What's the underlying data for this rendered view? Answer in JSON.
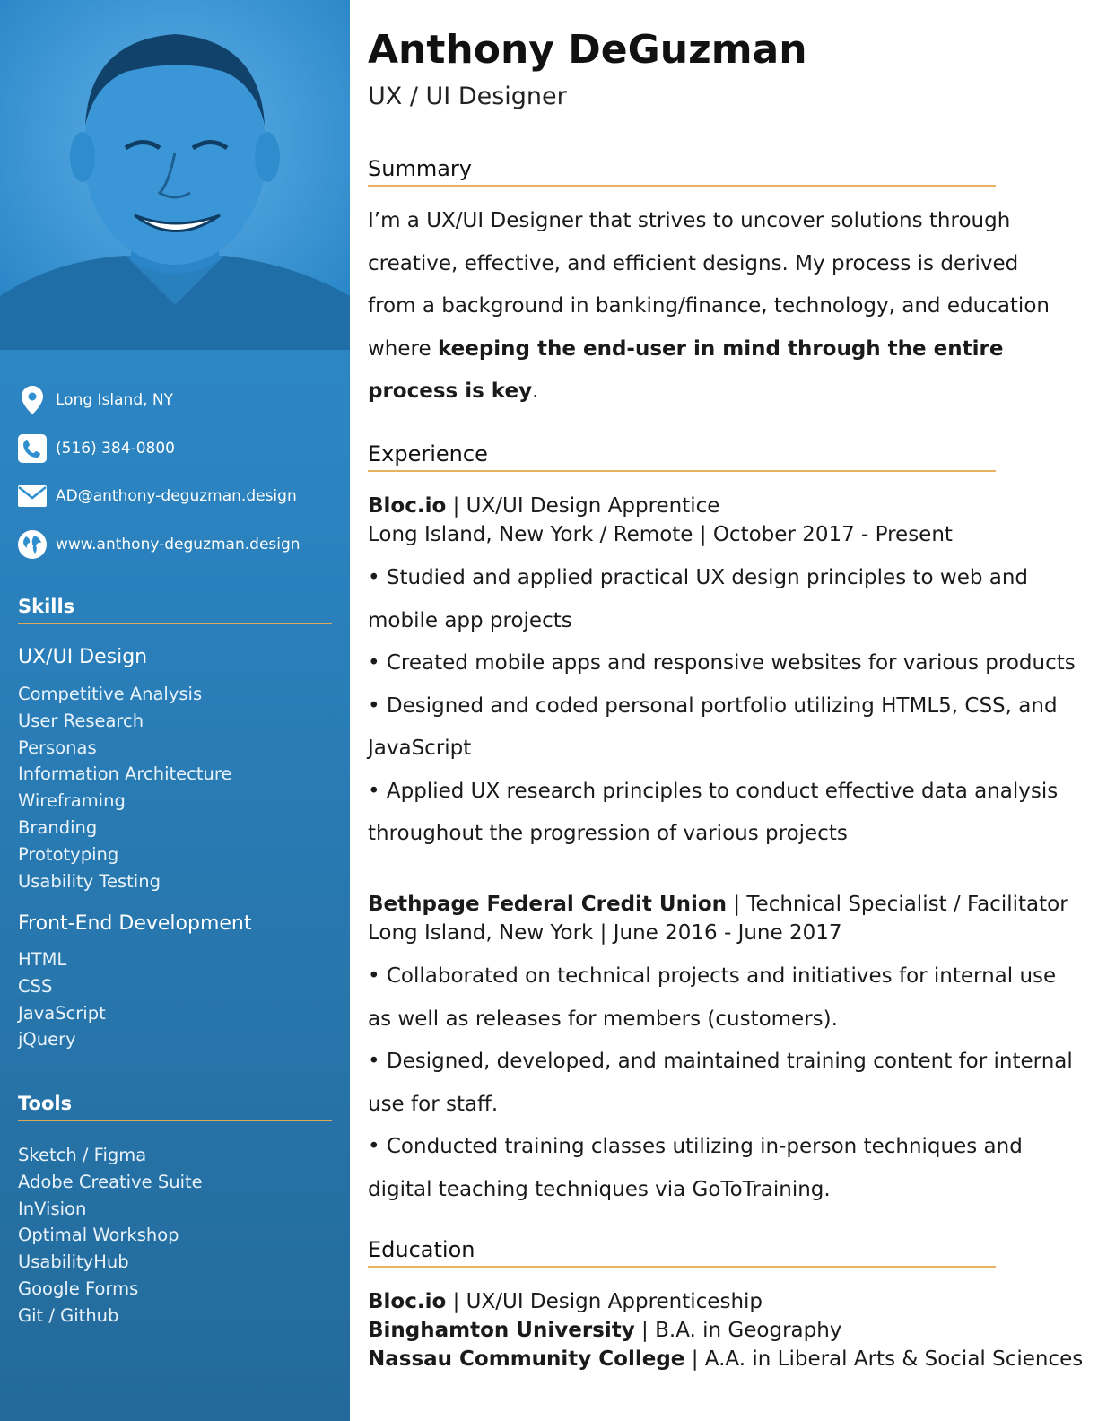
{
  "profile": {
    "name": "Anthony DeGuzman",
    "role": "UX / UI Designer"
  },
  "contact": {
    "location": "Long Island, NY",
    "phone": "(516) 384-0800",
    "email": "AD@anthony-deguzman.design",
    "website": "www.anthony-deguzman.design"
  },
  "skills": {
    "heading": "Skills",
    "groups": [
      {
        "title": "UX/UI Design",
        "items": [
          "Competitive Analysis",
          "User Research",
          "Personas",
          "Information Architecture",
          "Wireframing",
          "Branding",
          "Prototyping",
          "Usability Testing"
        ]
      },
      {
        "title": "Front-End Development",
        "items": [
          "HTML",
          "CSS",
          "JavaScript",
          "jQuery"
        ]
      }
    ]
  },
  "tools": {
    "heading": "Tools",
    "items": [
      "Sketch / Figma",
      "Adobe Creative Suite",
      "InVision",
      "Optimal Workshop",
      "UsabilityHub",
      "Google Forms",
      "Git / Github"
    ]
  },
  "summary": {
    "heading": "Summary",
    "text_plain": "I’m a UX/UI Designer that strives to uncover solutions through creative, effective, and efficient designs. My process is derived from a background in banking/finance, technology, and education where ",
    "text_bold": "keeping the end-user in mind through the entire process is key",
    "text_end": "."
  },
  "experience": {
    "heading": "Experience",
    "jobs": [
      {
        "company": "Bloc.io",
        "separator": " | ",
        "title": "UX/UI Design Apprentice",
        "meta": "Long Island, New York / Remote | October 2017 - Present",
        "bullets": [
          "• Studied and applied practical UX design principles to web and mobile app projects",
          "• Created mobile apps and responsive websites for various products",
          "• Designed and coded personal portfolio utilizing HTML5, CSS, and JavaScript",
          "• Applied UX research principles to conduct effective data analysis throughout the progression of various projects"
        ]
      },
      {
        "company": "Bethpage Federal Credit Union",
        "separator": " | ",
        "title": "Technical Specialist / Facilitator",
        "meta": "Long Island, New York | June 2016 - June 2017",
        "bullets": [
          "• Collaborated on technical projects and initiatives for internal use as well as releases for members (customers).",
          "• Designed, developed, and maintained training content for internal use for staff.",
          "• Conducted training classes utilizing in-person techniques and digital teaching techniques via GoToTraining."
        ]
      }
    ]
  },
  "education": {
    "heading": "Education",
    "entries": [
      {
        "school": "Bloc.io",
        "separator": " | ",
        "degree": "UX/UI Design Apprenticeship"
      },
      {
        "school": "Binghamton University",
        "separator": " | ",
        "degree": "B.A. in Geography"
      },
      {
        "school": "Nassau Community College",
        "separator": " | ",
        "degree": "A.A. in Liberal Arts & Social Sciences"
      }
    ]
  },
  "colors": {
    "sidebar_top": "#2f8fcf",
    "sidebar_bottom": "#236a9a",
    "accent_rule": "#e8b060"
  },
  "icons": [
    "map-pin-icon",
    "phone-icon",
    "mail-icon",
    "globe-icon"
  ]
}
